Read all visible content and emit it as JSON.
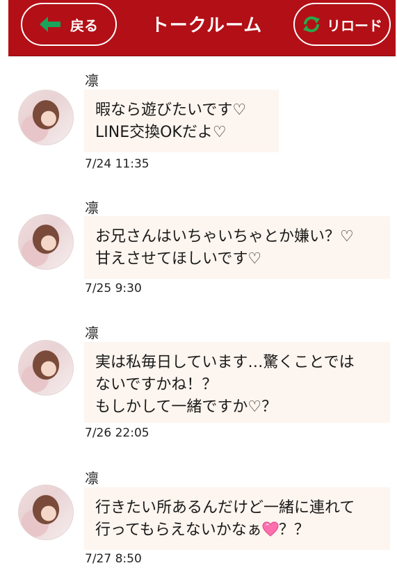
{
  "header": {
    "back_label": "戻る",
    "title": "トークルーム",
    "reload_label": "リロード",
    "colors": {
      "bar": "#b30f16",
      "back_arrow": "#19a35b",
      "reload_icon": "#2aa84a"
    }
  },
  "messages": [
    {
      "sender": "凛",
      "lines": [
        "暇なら遊びたいです♡",
        "LINE交換OKだよ♡"
      ],
      "time": "7/24 11:35"
    },
    {
      "sender": "凛",
      "lines": [
        "お兄さんはいちゃいちゃとか嫌い？♡",
        "甘えさせてほしいです♡"
      ],
      "time": "7/25 9:30"
    },
    {
      "sender": "凛",
      "lines": [
        "実は私毎日しています…驚くことでは",
        "ないですかね！？",
        "もしかして一緒ですか♡？"
      ],
      "time": "7/26 22:05"
    },
    {
      "sender": "凛",
      "lines": [
        "行きたい所あるんだけど一緒に連れて",
        "行ってもらえないかなぁ",
        "？？"
      ],
      "emoji": "pink-heart-icon",
      "time": "7/27 8:50"
    }
  ]
}
